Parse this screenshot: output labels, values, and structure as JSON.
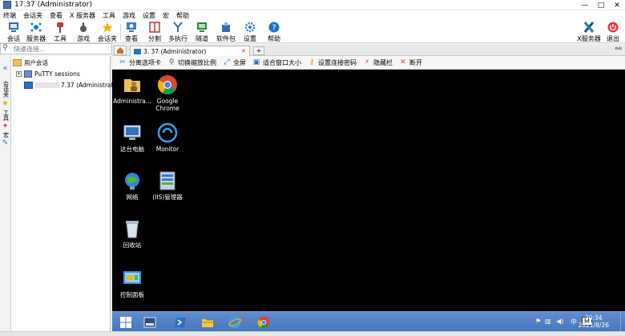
{
  "window": {
    "title": "17.37 (Administrator)",
    "minimize_label": "—",
    "maximize_label": "□",
    "close_label": "✕"
  },
  "menu": [
    "终端",
    "会话夹",
    "查看",
    "X 服务器",
    "工具",
    "游戏",
    "设置",
    "宏",
    "帮助"
  ],
  "toolbar": {
    "items": [
      {
        "label": "会话",
        "icon": "session-icon",
        "color": "#2f6db5"
      },
      {
        "label": "服务器",
        "icon": "servers-icon",
        "color": "#1f7ac9"
      },
      {
        "label": "工具",
        "icon": "tools-icon",
        "color": "#d9332b"
      },
      {
        "label": "游戏",
        "icon": "games-icon",
        "color": "#5a5a5a"
      },
      {
        "label": "会话夹",
        "icon": "star-icon",
        "color": "#f2b500"
      },
      {
        "label": "查看",
        "icon": "view-icon",
        "color": "#3a7bd5"
      },
      {
        "label": "分割",
        "icon": "split-icon",
        "color": "#c8342b"
      },
      {
        "label": "多执行",
        "icon": "multiexec-icon",
        "color": "#2f6db5"
      },
      {
        "label": "隧道",
        "icon": "tunnel-icon",
        "color": "#2a8a3a"
      },
      {
        "label": "软件包",
        "icon": "packages-icon",
        "color": "#3a6aa8"
      },
      {
        "label": "设置",
        "icon": "gear-icon",
        "color": "#2f7fd0"
      },
      {
        "label": "帮助",
        "icon": "help-icon",
        "color": "#1a73c9"
      }
    ],
    "xserver_label": "X服务器",
    "exit_label": "退出"
  },
  "sidebar": {
    "quick_connect_placeholder": "快速连接...",
    "tree": {
      "root": "用户会话",
      "putty": "PuTTY sessions",
      "session": "7.37 (Administrator)"
    },
    "strip_labels": [
      "会话夹",
      "工具",
      "宏"
    ]
  },
  "tabs": {
    "active_tab": "3.       37 (Administrator)",
    "close_glyph": "✕"
  },
  "session_toolbar": {
    "items": [
      {
        "label": "分离选项卡",
        "icon": "detach-icon"
      },
      {
        "label": "切换缩放比例",
        "icon": "zoom-icon"
      },
      {
        "label": "全屏",
        "icon": "fullscreen-icon"
      },
      {
        "label": "适合窗口大小",
        "icon": "fit-window-icon"
      },
      {
        "label": "设置连接密码",
        "icon": "key-icon"
      },
      {
        "label": "隐藏栏",
        "icon": "pin-icon"
      },
      {
        "label": "断开",
        "icon": "disconnect-icon"
      }
    ]
  },
  "desktop": {
    "icons": [
      {
        "label": "Administra...",
        "icon": "user-folder-icon"
      },
      {
        "label": "Google\nChrome",
        "icon": "chrome-icon"
      },
      {
        "label": "这台电脑",
        "icon": "computer-icon"
      },
      {
        "label": "Monitor",
        "icon": "monitor-icon"
      },
      {
        "label": "网络",
        "icon": "network-icon"
      },
      {
        "label": "(IIS)管理器",
        "icon": "iis-icon"
      },
      {
        "label": "回收站",
        "icon": "recycle-bin-icon"
      },
      {
        "label": "控制面板",
        "icon": "control-panel-icon"
      }
    ]
  },
  "taskbar": {
    "time": "20:34",
    "date": "2021/8/26",
    "ime": "M",
    "lang": "中"
  }
}
